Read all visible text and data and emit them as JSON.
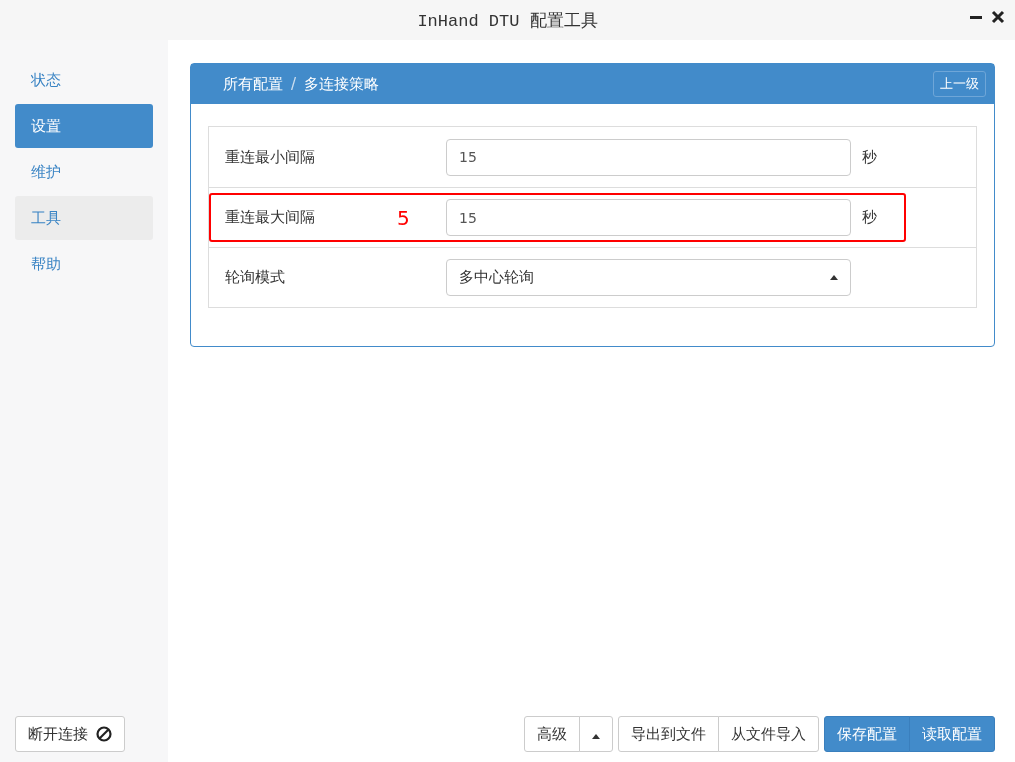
{
  "window": {
    "title": "InHand DTU 配置工具"
  },
  "sidebar": {
    "items": [
      {
        "label": "状态",
        "selected": false,
        "hovered": false
      },
      {
        "label": "设置",
        "selected": true,
        "hovered": false
      },
      {
        "label": "维护",
        "selected": false,
        "hovered": false
      },
      {
        "label": "工具",
        "selected": false,
        "hovered": true
      },
      {
        "label": "帮助",
        "selected": false,
        "hovered": false
      }
    ],
    "disconnect_button": "断开连接"
  },
  "panel": {
    "breadcrumb": [
      "所有配置",
      "多连接策略"
    ],
    "separator": "/",
    "up_button": "上一级",
    "rows": [
      {
        "kind": "input",
        "label": "重连最小间隔",
        "value": "15",
        "unit": "秒",
        "annotation": null
      },
      {
        "kind": "input",
        "label": "重连最大间隔",
        "value": "15",
        "unit": "秒",
        "annotation": "5"
      },
      {
        "kind": "select",
        "label": "轮询模式",
        "value": "多中心轮询",
        "annotation": null
      }
    ]
  },
  "footer": {
    "groups": [
      [
        {
          "label": "高级",
          "kind": "text"
        },
        {
          "kind": "caret"
        }
      ],
      [
        {
          "label": "导出到文件",
          "kind": "text"
        },
        {
          "label": "从文件导入",
          "kind": "text"
        }
      ],
      [
        {
          "label": "保存配置",
          "kind": "primary"
        },
        {
          "label": "读取配置",
          "kind": "primary"
        }
      ]
    ]
  }
}
